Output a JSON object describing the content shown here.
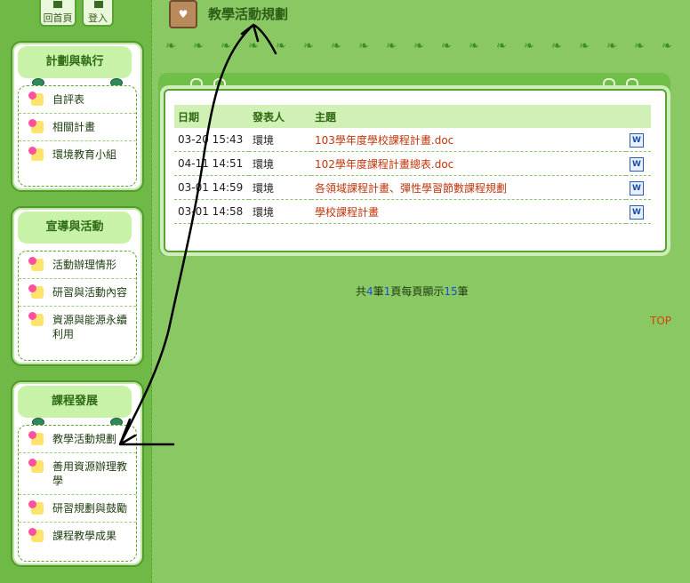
{
  "top_buttons": [
    {
      "label": "回首頁"
    },
    {
      "label": "登入"
    }
  ],
  "sidebar": {
    "panels": [
      {
        "title": "計劃與執行",
        "items": [
          "自評表",
          "相關計畫",
          "環境教育小組"
        ]
      },
      {
        "title": "宣導與活動",
        "items": [
          "活動辦理情形",
          "研習與活動內容",
          "資源與能源永續利用"
        ]
      },
      {
        "title": "課程發展",
        "items": [
          "教學活動規劃",
          "善用資源辦理教學",
          "研習規劃與鼓勵",
          "課程教學成果"
        ]
      }
    ]
  },
  "header": {
    "title": "教學活動規劃",
    "icon": "sign-heart-icon"
  },
  "table": {
    "columns": [
      "日期",
      "發表人",
      "主題"
    ],
    "rows": [
      {
        "date": "03-20 15:43",
        "author": "環境",
        "topic": "103學年度學校課程計畫.doc"
      },
      {
        "date": "04-11 14:51",
        "author": "環境",
        "topic": "102學年度課程計畫總表.doc"
      },
      {
        "date": "03-01 14:59",
        "author": "環境",
        "topic": "各領域課程計畫、彈性學習節數課程規劃"
      },
      {
        "date": "03-01 14:58",
        "author": "環境",
        "topic": "學校課程計畫"
      }
    ],
    "doc_icon": "word-doc-icon",
    "doc_icon_text": "W"
  },
  "pager": {
    "prefix": "共",
    "count": "4",
    "mid1": "筆",
    "page": "1",
    "mid2": "頁每頁顯示",
    "per_page": "15",
    "suffix": "筆"
  },
  "top_link": "TOP",
  "leaf_glyph": "❧",
  "colors": {
    "accent": "#2d6a12",
    "link": "#c0360c",
    "number": "#1a4fd8"
  }
}
